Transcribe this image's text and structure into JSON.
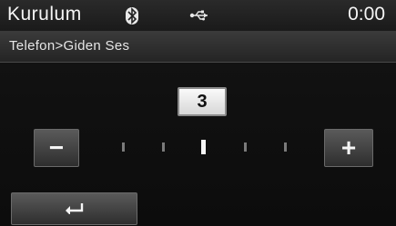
{
  "status_bar": {
    "title": "Kurulum",
    "clock": "0:00",
    "icons": [
      "bluetooth-icon",
      "usb-icon"
    ]
  },
  "header": {
    "breadcrumb": "Telefon>Giden Ses"
  },
  "volume": {
    "value": "3",
    "min": 1,
    "max": 5,
    "decrease_label": "−",
    "increase_label": "+"
  },
  "footer": {
    "back_icon": "back-arrow-icon"
  }
}
